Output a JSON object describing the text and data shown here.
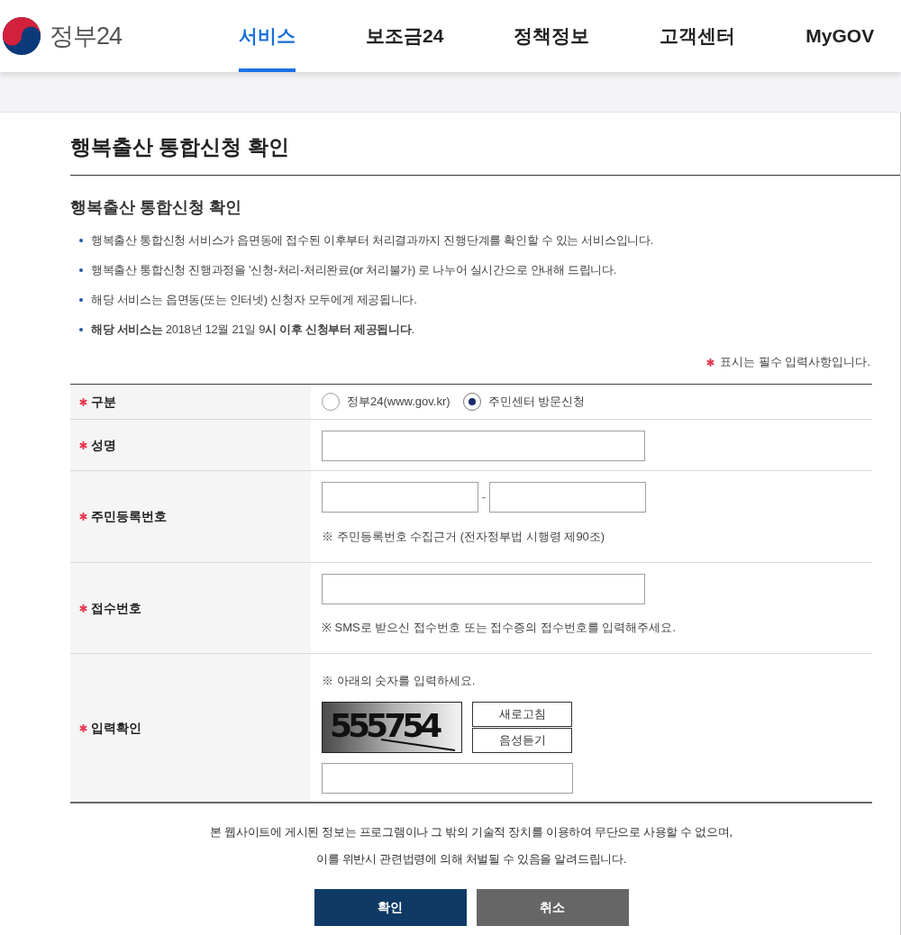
{
  "header": {
    "logo": {
      "text": "정부24"
    },
    "nav": [
      {
        "label": "서비스",
        "selected": true
      },
      {
        "label": "보조금24",
        "selected": false
      },
      {
        "label": "정책정보",
        "selected": false
      },
      {
        "label": "고객센터",
        "selected": false
      },
      {
        "label": "MyGOV",
        "selected": false
      }
    ]
  },
  "page": {
    "title": "행복출산 통합신청 확인"
  },
  "section": {
    "title": "행복출산 통합신청 확인",
    "bullets": [
      "행복출산 통합신청 서비스가 읍면동에 접수된 이후부터 처리결과까지 진행단계를 확인할 수 있는 서비스입니다.",
      "행복출산 통합신청 진행과정을 '신청-처리-처리완료(or 처리불가) 로 나누어 실시간으로 안내해 드립니다.",
      "해당 서비스는 읍면동(또는 인터넷) 신청자 모두에게 제공됩니다.",
      "**해당 서비스는** 2018년 12월 21일 9**시 이후 신청부터 제공됩니다**."
    ],
    "required_note": "표시는 필수 입력사항입니다."
  },
  "form": {
    "rows": [
      {
        "kind": "radio",
        "label": "구분",
        "required": true,
        "options": [
          {
            "label": "정부24(www.gov.kr)",
            "selected": false
          },
          {
            "label": "주민센터 방문신청",
            "selected": true
          }
        ]
      },
      {
        "kind": "text",
        "label": "성명",
        "required": true
      },
      {
        "kind": "split",
        "label": "주민등록번호",
        "required": true,
        "separator": "-",
        "note": "※ 주민등록번호 수집근거 (전자정부법 시행령 제90조)"
      },
      {
        "kind": "text",
        "label": "접수번호",
        "required": true,
        "note": "※ SMS로 받으신 접수번호 또는 접수증의 접수번호를 입력해주세요."
      },
      {
        "kind": "captcha",
        "label": "입력확인",
        "required": true,
        "note": "※ 아래의 숫자를 입력하세요.",
        "code": "555754",
        "buttons": [
          "새로고침",
          "음성듣기"
        ]
      }
    ]
  },
  "notice": [
    "본 웹사이트에 게시된 정보는 프로그램이나 그 밖의 기술적 장치를 이용하여 무단으로 사용할 수 없으며,",
    "이를 위반시 관련법령에 의해 처벌될 수 있음을 알려드립니다."
  ],
  "buttons": [
    {
      "label": "확인",
      "kind": "primary"
    },
    {
      "label": "취소",
      "kind": "secondary"
    }
  ]
}
